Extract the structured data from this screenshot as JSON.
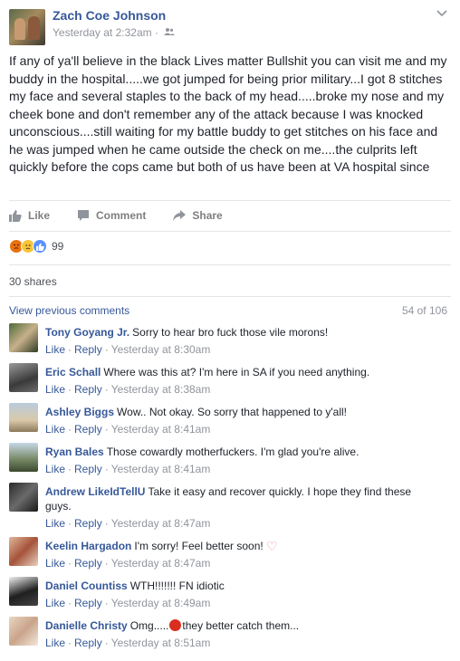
{
  "post": {
    "author": "Zach Coe Johnson",
    "timestamp": "Yesterday at 2:32am",
    "privacy_icon": "friends-icon",
    "body": "If any of ya'll believe in the black Lives matter Bullshit you can visit me and my buddy in the hospital.....we got jumped for being prior military...I got 8 stitches my face and several staples to the back of my head.....broke my nose and my cheek bone and don't remember any of the attack because I was knocked unconscious....still waiting for my battle buddy to get stitches on his face and he was jumped when he came outside the check on me....the culprits left quickly before the cops came but both of us have been at VA hospital since"
  },
  "actions": {
    "like": "Like",
    "comment": "Comment",
    "share": "Share"
  },
  "reactions": {
    "types": [
      "angry",
      "sad",
      "like"
    ],
    "count": "99"
  },
  "shares": "30 shares",
  "comments_header": {
    "view_previous": "View previous comments",
    "count": "54 of 106"
  },
  "comment_actions": {
    "like": "Like",
    "reply": "Reply"
  },
  "comments": [
    {
      "name": "Tony Goyang Jr.",
      "text": "Sorry to hear bro fuck those vile morons!",
      "time": "Yesterday at 8:30am"
    },
    {
      "name": "Eric Schall",
      "text": "Where was this at? I'm here in SA if you need anything.",
      "time": "Yesterday at 8:38am"
    },
    {
      "name": "Ashley Biggs",
      "text": "Wow.. Not okay. So sorry that happened to y'all!",
      "time": "Yesterday at 8:41am"
    },
    {
      "name": "Ryan Bales",
      "text": "Those cowardly motherfuckers. I'm glad you're alive.",
      "time": "Yesterday at 8:41am"
    },
    {
      "name": "Andrew LikeIdTellU",
      "text": "Take it easy and recover quickly. I hope they find these guys.",
      "time": "Yesterday at 8:47am"
    },
    {
      "name": "Keelin Hargadon",
      "text": "I'm sorry! Feel better soon!",
      "time": "Yesterday at 8:47am"
    },
    {
      "name": "Daniel Countiss",
      "text": "WTH!!!!!!! FN idiotic",
      "time": "Yesterday at 8:49am"
    },
    {
      "name": "Danielle Christy",
      "text_before": "Omg.....",
      "text_after": "they better catch them...",
      "time": "Yesterday at 8:51am"
    }
  ],
  "colors": {
    "link": "#365899",
    "meta": "#90949c",
    "text": "#1d2129"
  }
}
